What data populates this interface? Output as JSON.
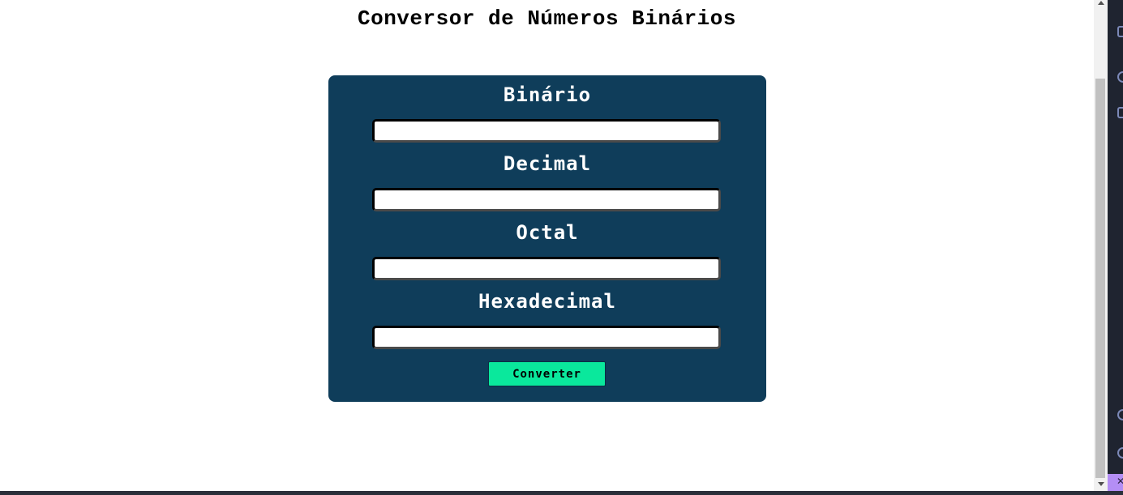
{
  "page": {
    "title": "Conversor de Números Binários"
  },
  "form": {
    "fields": [
      {
        "label": "Binário",
        "value": "",
        "placeholder": ""
      },
      {
        "label": "Decimal",
        "value": "",
        "placeholder": ""
      },
      {
        "label": "Octal",
        "value": "",
        "placeholder": ""
      },
      {
        "label": "Hexadecimal",
        "value": "",
        "placeholder": ""
      }
    ],
    "convert_label": "Converter"
  },
  "colors": {
    "card_background": "#0f3d5a",
    "button_accent": "#0ae89c",
    "editor_strip": "#1f2430",
    "editor_accent": "#b48ef5"
  },
  "icons": [
    "scroll-up-icon",
    "scroll-down-icon",
    "editor-sidebar-icon"
  ]
}
